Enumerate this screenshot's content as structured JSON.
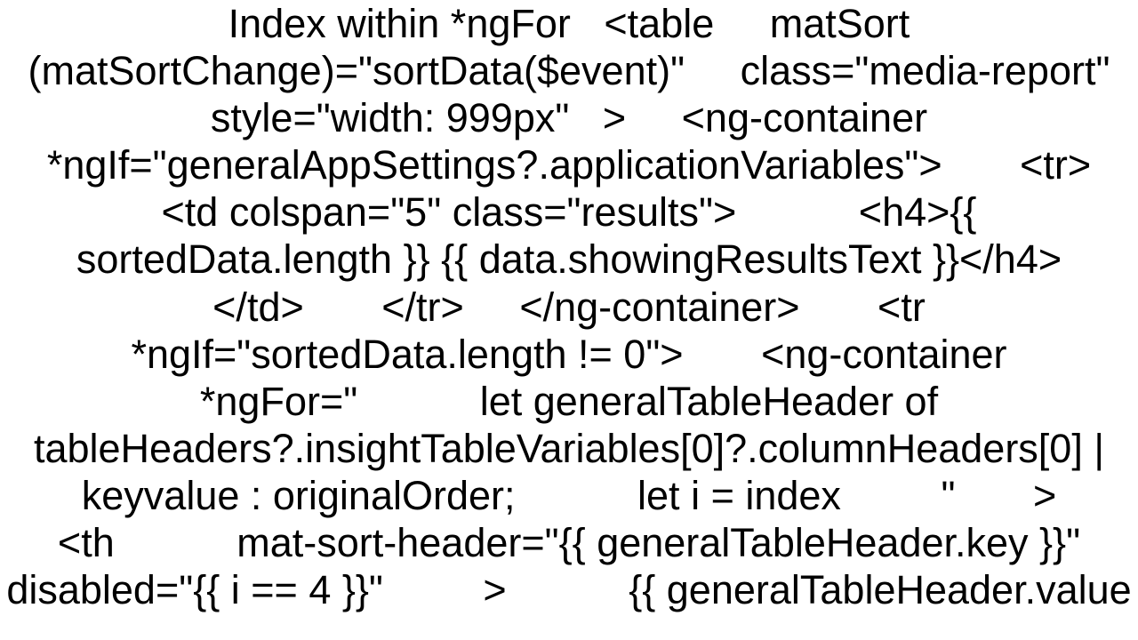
{
  "content": {
    "text": "Index within *ngFor   <table     matSort     (matSortChange)=\"sortData($event)\"     class=\"media-report\"     style=\"width: 999px\"   >     <ng-container *ngIf=\"generalAppSettings?.applicationVariables\">       <tr>         <td colspan=\"5\" class=\"results\">           <h4>{{ sortedData.length }} {{ data.showingResultsText }}</h4>         </td>       </tr>     </ng-container>       <tr *ngIf=\"sortedData.length != 0\">       <ng-container         *ngFor=\"           let generalTableHeader of tableHeaders?.insightTableVariables[0]?.columnHeaders[0] | keyvalue : originalOrder;           let i = index         \"       >         <th           mat-sort-header=\"{{ generalTableHeader.key }}\"           disabled=\"{{ i == 4 }}\"         >           {{ generalTableHeader.value"
  }
}
